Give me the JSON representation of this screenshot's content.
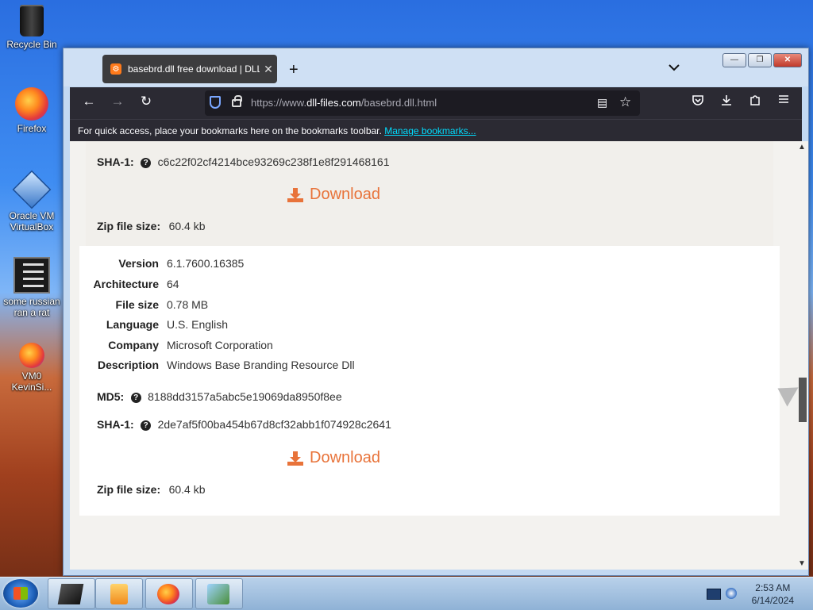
{
  "desktop": {
    "icons": [
      {
        "label": "Recycle Bin"
      },
      {
        "label": "Firefox"
      },
      {
        "label": "Oracle VM VirtualBox"
      },
      {
        "label": "some russian ran a rat"
      },
      {
        "label": "VM0 KevinSi..."
      }
    ]
  },
  "browser": {
    "tab": {
      "title": "basebrd.dll free download | DLL",
      "close": "✕"
    },
    "new_tab": "+",
    "tab_list": "⌄",
    "window_buttons": {
      "minimize": "—",
      "restore": "❐",
      "close": "✕"
    },
    "nav": {
      "back": "←",
      "forward": "→",
      "reload": "↻"
    },
    "url": {
      "prefix": "https://www.",
      "domain": "dll-files.com",
      "path": "/basebrd.dll.html"
    },
    "bookmarks_bar": {
      "text": "For quick access, place your bookmarks here on the bookmarks toolbar.",
      "link": "Manage bookmarks..."
    }
  },
  "page": {
    "top_card": {
      "sha1_label": "SHA-1:",
      "sha1_value": "c6c22f02cf4214bce93269c238f1e8f291468161",
      "download_label": "Download",
      "zip_label": "Zip file size:",
      "zip_value": "60.4 kb"
    },
    "main_card": {
      "properties": [
        {
          "label": "Version",
          "value": "6.1.7600.16385"
        },
        {
          "label": "Architecture",
          "value": "64"
        },
        {
          "label": "File size",
          "value": "0.78 MB"
        },
        {
          "label": "Language",
          "value": "U.S. English"
        },
        {
          "label": "Company",
          "value": "Microsoft Corporation"
        },
        {
          "label": "Description",
          "value": "Windows Base Branding Resource Dll"
        }
      ],
      "md5_label": "MD5:",
      "md5_value": "8188dd3157a5abc5e19069da8950f8ee",
      "sha1_label": "SHA-1:",
      "sha1_value": "2de7af5f00ba454b67d8cf32abb1f074928c2641",
      "download_label": "Download",
      "zip_label": "Zip file size:",
      "zip_value": "60.4 kb"
    }
  },
  "taskbar": {
    "time": "2:53 AM",
    "date": "6/14/2024"
  }
}
